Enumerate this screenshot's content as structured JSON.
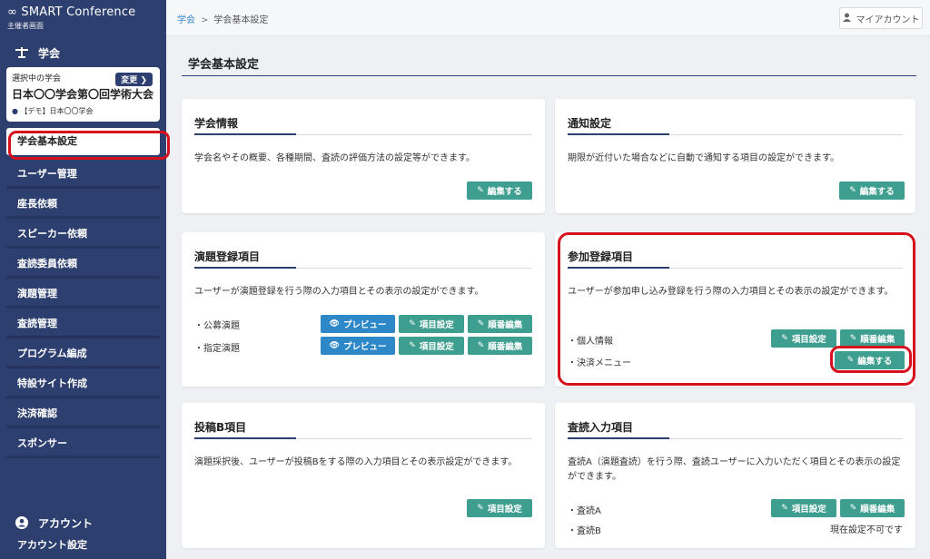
{
  "brand": {
    "title": "SMART Conference",
    "subtitle": "主催者画面"
  },
  "sidebar": {
    "section_society": "学会",
    "society_card": {
      "label": "選択中の学会",
      "change_label": "変更",
      "name": "日本〇〇学会第〇回学術大会",
      "org": "【デモ】日本〇〇学会"
    },
    "items": [
      {
        "label": "学会基本設定"
      },
      {
        "label": "ユーザー管理"
      },
      {
        "label": "座長依頼"
      },
      {
        "label": "スピーカー依頼"
      },
      {
        "label": "査読委員依頼"
      },
      {
        "label": "演題管理"
      },
      {
        "label": "査読管理"
      },
      {
        "label": "プログラム編成"
      },
      {
        "label": "特設サイト作成"
      },
      {
        "label": "決済確認"
      },
      {
        "label": "スポンサー"
      }
    ],
    "section_account": "アカウント",
    "account_item": "アカウント設定"
  },
  "topbar": {
    "breadcrumb_root": "学会",
    "breadcrumb_sep": ">",
    "breadcrumb_current": "学会基本設定",
    "account_button": "マイアカウント"
  },
  "page": {
    "title": "学会基本設定"
  },
  "cards": {
    "society_info": {
      "title": "学会情報",
      "desc": "学会名やその概要、各種期間、査読の評価方法の設定等ができます。",
      "edit": "編集する"
    },
    "notifications": {
      "title": "通知設定",
      "desc": "期限が近付いた場合などに自動で通知する項目の設定ができます。",
      "edit": "編集する"
    },
    "abstract_items": {
      "title": "演題登録項目",
      "desc": "ユーザーが演題登録を行う際の入力項目とその表示の設定ができます。",
      "rows": [
        {
          "label": "・公募演題",
          "preview": "プレビュー",
          "items": "項目設定",
          "order": "順番編集"
        },
        {
          "label": "・指定演題",
          "preview": "プレビュー",
          "items": "項目設定",
          "order": "順番編集"
        }
      ]
    },
    "participant_items": {
      "title": "参加登録項目",
      "desc": "ユーザーが参加申し込み登録を行う際の入力項目とその表示の設定ができます。",
      "row1": {
        "label": "・個人情報",
        "items": "項目設定",
        "order": "順番編集"
      },
      "row2": {
        "label": "・決済メニュー",
        "edit": "編集する"
      }
    },
    "submission_b": {
      "title": "投稿B項目",
      "desc": "演題採択後、ユーザーが投稿Bをする際の入力項目とその表示設定ができます。",
      "items": "項目設定"
    },
    "review_input": {
      "title": "査読入力項目",
      "desc": "査読A（演題査読）を行う際、査読ユーザーに入力いただく項目とその表示の設定ができます。",
      "row1": {
        "label": "・査読A",
        "items": "項目設定",
        "order": "順番編集"
      },
      "row2": {
        "label": "・査読B",
        "note": "現在設定不可です"
      }
    }
  },
  "colors": {
    "sidebar": "#2d3f6e",
    "teal_button": "#3e9e8f",
    "blue_button": "#2e88c7",
    "highlight": "#d6101d"
  }
}
